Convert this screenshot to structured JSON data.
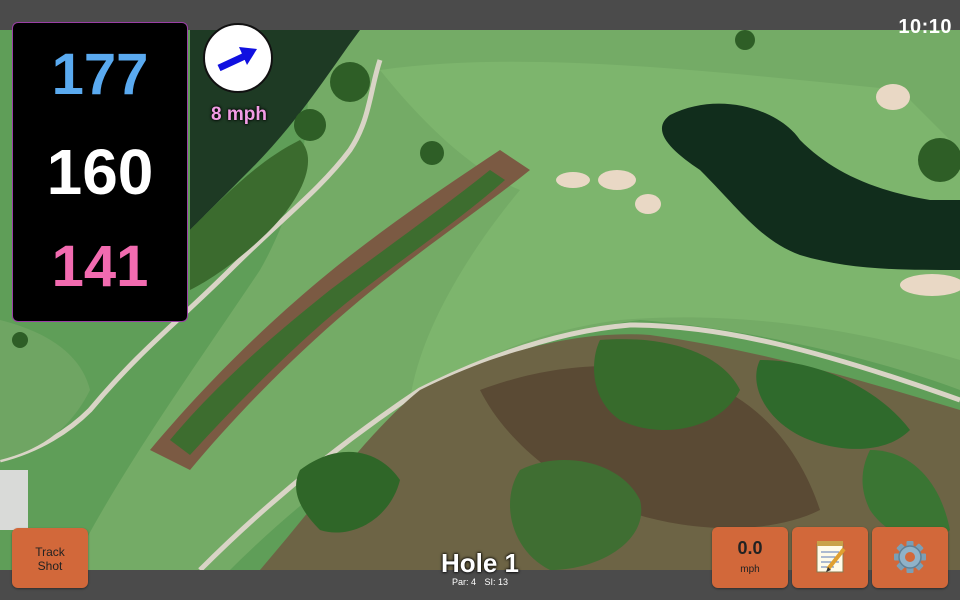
{
  "status": {
    "time": "10:10"
  },
  "yardage": {
    "back": "177",
    "middle": "160",
    "front": "141"
  },
  "wind": {
    "speed_label": "8 mph",
    "icon": "wind-arrow-icon"
  },
  "hole": {
    "title": "Hole 1",
    "par_label": "Par: 4",
    "si_label": "SI: 13"
  },
  "buttons": {
    "track_shot_line1": "Track",
    "track_shot_line2": "Shot",
    "speed_value": "0.0",
    "speed_unit": "mph",
    "notes_icon": "notepad-icon",
    "settings_icon": "gear-icon"
  },
  "colors": {
    "back_yardage": "#5aaaf0",
    "middle_yardage": "#ffffff",
    "front_yardage": "#f26bb0",
    "wind_text": "#f29ce5",
    "button": "#d2683a",
    "bar": "#4b4b4b"
  }
}
